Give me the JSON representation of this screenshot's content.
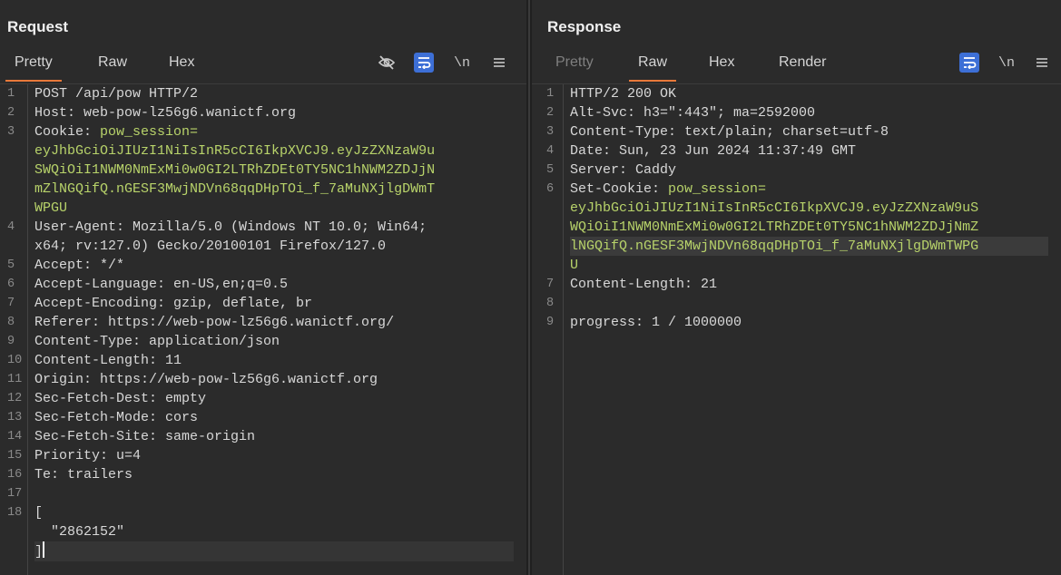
{
  "request": {
    "title": "Request",
    "tabs": [
      {
        "label": "Pretty",
        "active": true
      },
      {
        "label": "Raw"
      },
      {
        "label": "Hex"
      }
    ],
    "lines": [
      {
        "num": "1",
        "text": "POST /api/pow HTTP/2"
      },
      {
        "num": "2",
        "text": "Host: web-pow-lz56g6.wanictf.org"
      },
      {
        "num": "3",
        "text": "Cookie: pow_session="
      },
      {
        "num": "",
        "text": "eyJhbGciOiJIUzI1NiIsInR5cCI6IkpXVCJ9.eyJzZXNzaW9u",
        "cookie": true
      },
      {
        "num": "",
        "text": "SWQiOiI1NWM0NmExMi0w0GI2LTRhZDEt0TY5NC1hNWM2ZDJjN",
        "cookie": true
      },
      {
        "num": "",
        "text": "mZlNGQifQ.nGESF3MwjNDVn68qqDHpTOi_f_7aMuNXjlgDWmT",
        "cookie": true
      },
      {
        "num": "",
        "text": "WPGU",
        "cookie": true
      },
      {
        "num": "4",
        "text": "User-Agent: Mozilla/5.0 (Windows NT 10.0; Win64;"
      },
      {
        "num": "",
        "text": "x64; rv:127.0) Gecko/20100101 Firefox/127.0"
      },
      {
        "num": "5",
        "text": "Accept: */*"
      },
      {
        "num": "6",
        "text": "Accept-Language: en-US,en;q=0.5"
      },
      {
        "num": "7",
        "text": "Accept-Encoding: gzip, deflate, br"
      },
      {
        "num": "8",
        "text": "Referer: https://web-pow-lz56g6.wanictf.org/"
      },
      {
        "num": "9",
        "text": "Content-Type: application/json"
      },
      {
        "num": "10",
        "text": "Content-Length: 11"
      },
      {
        "num": "11",
        "text": "Origin: https://web-pow-lz56g6.wanictf.org"
      },
      {
        "num": "12",
        "text": "Sec-Fetch-Dest: empty"
      },
      {
        "num": "13",
        "text": "Sec-Fetch-Mode: cors"
      },
      {
        "num": "14",
        "text": "Sec-Fetch-Site: same-origin"
      },
      {
        "num": "15",
        "text": "Priority: u=4"
      },
      {
        "num": "16",
        "text": "Te: trailers"
      },
      {
        "num": "17",
        "text": ""
      },
      {
        "num": "18",
        "text": "["
      },
      {
        "num": "",
        "text": "  \"2862152\""
      },
      {
        "num": "",
        "text": "]",
        "cursor": true
      }
    ]
  },
  "response": {
    "title": "Response",
    "tabs": [
      {
        "label": "Pretty",
        "dim": true
      },
      {
        "label": "Raw",
        "active": true
      },
      {
        "label": "Hex"
      },
      {
        "label": "Render"
      }
    ],
    "lines": [
      {
        "num": "1",
        "text": "HTTP/2 200 OK"
      },
      {
        "num": "2",
        "text": "Alt-Svc: h3=\":443\"; ma=2592000"
      },
      {
        "num": "3",
        "text": "Content-Type: text/plain; charset=utf-8"
      },
      {
        "num": "4",
        "text": "Date: Sun, 23 Jun 2024 11:37:49 GMT"
      },
      {
        "num": "5",
        "text": "Server: Caddy"
      },
      {
        "num": "6",
        "text": "Set-Cookie: pow_session="
      },
      {
        "num": "",
        "text": "eyJhbGciOiJIUzI1NiIsInR5cCI6IkpXVCJ9.eyJzZXNzaW9uS",
        "cookie": true
      },
      {
        "num": "",
        "text": "WQiOiI1NWM0NmExMi0w0GI2LTRhZDEt0TY5NC1hNWM2ZDJjNmZ",
        "cookie": true
      },
      {
        "num": "",
        "text": "lNGQifQ.nGESF3MwjNDVn68qqDHpTOi_f_7aMuNXjlgDWmTWPG",
        "cookie": true,
        "hl": true
      },
      {
        "num": "",
        "text": "U",
        "cookie": true
      },
      {
        "num": "7",
        "text": "Content-Length: 21"
      },
      {
        "num": "8",
        "text": ""
      },
      {
        "num": "9",
        "text": "progress: 1 / 1000000"
      }
    ]
  },
  "icons": {
    "hide": "eye-slash-icon",
    "wrap": "text-wrap-icon",
    "newline": "\\n",
    "menu": "hamburger-menu-icon"
  },
  "colors": {
    "accent": "#e8793a",
    "selected": "#3d6fd6",
    "cookie": "#b8d36a"
  }
}
